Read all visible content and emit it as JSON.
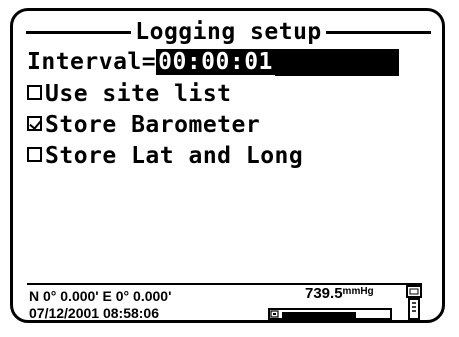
{
  "screen": {
    "title": "Logging setup",
    "interval": {
      "label": "Interval=",
      "value": "00:00:01"
    },
    "options": [
      {
        "label": "Use site list",
        "checked": false
      },
      {
        "label": "Store Barometer",
        "checked": true
      },
      {
        "label": "Store Lat and Long",
        "checked": false
      }
    ]
  },
  "status_bar": {
    "coordinates": "N 0° 0.000' E  0° 0.000'",
    "datetime": "07/12/2001 08:58:06",
    "pressure_value": "739.5",
    "pressure_unit": "mmHg",
    "battery_level": 0.7
  }
}
